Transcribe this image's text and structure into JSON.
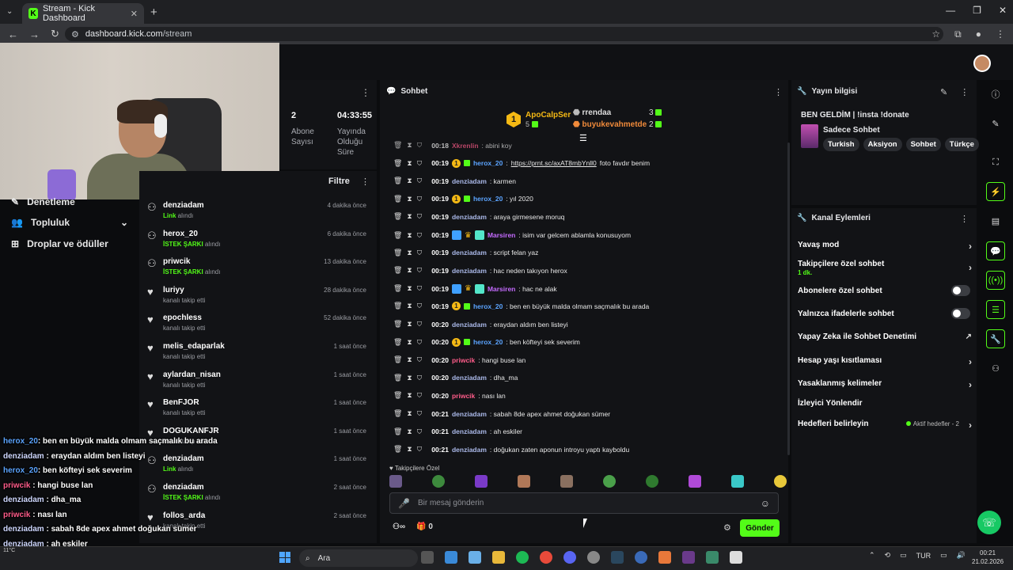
{
  "browser": {
    "tab_title": "Stream - Kick Dashboard",
    "url_host": "dashboard.kick.com",
    "url_path": "/stream"
  },
  "nav": {
    "items": [
      {
        "label": "Denetleme"
      },
      {
        "label": "Topluluk"
      },
      {
        "label": "Droplar ve ödüller"
      }
    ]
  },
  "stats": [
    {
      "value": "2",
      "label": "Abone Sayısı"
    },
    {
      "value": "04:33:55",
      "label": "Yayında Olduğu Süre"
    }
  ],
  "feed": {
    "title": "Filtre",
    "items": [
      {
        "user": "denziadam",
        "highlight": "Link",
        "action": " alındı",
        "time": "4 dakika önce",
        "type": "gift"
      },
      {
        "user": "herox_20",
        "highlight": "İSTEK ŞARKI",
        "action": " alındı",
        "time": "6 dakika önce",
        "type": "gift"
      },
      {
        "user": "priwcik",
        "highlight": "İSTEK ŞARKI",
        "action": " alındı",
        "time": "13 dakika önce",
        "type": "gift"
      },
      {
        "user": "luriyy",
        "highlight": "",
        "action": "kanalı takip etti",
        "time": "28 dakika önce",
        "type": "follow"
      },
      {
        "user": "epochless",
        "highlight": "",
        "action": "kanalı takip etti",
        "time": "52 dakika önce",
        "type": "follow"
      },
      {
        "user": "melis_edaparlak",
        "highlight": "",
        "action": "kanalı takip etti",
        "time": "1 saat önce",
        "type": "follow"
      },
      {
        "user": "aylardan_nisan",
        "highlight": "",
        "action": "kanalı takip etti",
        "time": "1 saat önce",
        "type": "follow"
      },
      {
        "user": "BenFJOR",
        "highlight": "",
        "action": "kanalı takip etti",
        "time": "1 saat önce",
        "type": "follow"
      },
      {
        "user": "DOGUKANFJR",
        "highlight": "",
        "action": "kanalı takip etti",
        "time": "1 saat önce",
        "type": "follow"
      },
      {
        "user": "denziadam",
        "highlight": "Link",
        "action": " alındı",
        "time": "1 saat önce",
        "type": "gift"
      },
      {
        "user": "denziadam",
        "highlight": "İSTEK ŞARKI",
        "action": " alındı",
        "time": "2 saat önce",
        "type": "gift"
      },
      {
        "user": "follos_arda",
        "highlight": "",
        "action": "kanalı takip etti",
        "time": "2 saat önce",
        "type": "follow"
      }
    ]
  },
  "overlay_chat": [
    {
      "user": "herox_20",
      "text": ": ben en büyük malda olmam saçmalık bu arada",
      "color": "n3"
    },
    {
      "user": "denziadam",
      "text": " : eraydan aldım ben listeyi",
      "color": "n1"
    },
    {
      "user": "herox_20",
      "text": ": ben köfteyi sek severim",
      "color": "n3"
    },
    {
      "user": "priwcik",
      "text": " : hangi buse lan",
      "color": "n2"
    },
    {
      "user": "denziadam",
      "text": " : dha_ma",
      "color": "n1"
    },
    {
      "user": "priwcik",
      "text": " : nası lan",
      "color": "n2"
    },
    {
      "user": "denziadam",
      "text": " : sabah 8de apex ahmet doğukan sümer",
      "color": "n1"
    },
    {
      "user": "denziadam",
      "text": " : ah eskiler",
      "color": "n1"
    },
    {
      "user": "iadam",
      "text": " : doğukan zaten aponun introyu yaptı kayboldu",
      "color": "n1"
    }
  ],
  "chat": {
    "title": "Sohbet",
    "top_gifters": [
      {
        "rank": "1",
        "name": "ApoCalpSer",
        "count": "5"
      },
      {
        "name": "rrendaa",
        "count": "3"
      },
      {
        "name": "buyukevahmetde",
        "count": "2"
      }
    ],
    "messages": [
      {
        "ts": "00:18",
        "user": "Xkrenlin",
        "text": ": abini koy",
        "color": "c4",
        "badges": ""
      },
      {
        "ts": "00:19",
        "user": "herox_20",
        "text": " foto favdır benim",
        "link": "https://prnt.sc/axAT8mbYnll0",
        "color": "c2",
        "badges": "coin"
      },
      {
        "ts": "00:19",
        "user": "denziadam",
        "text": ": karmen",
        "color": "c1",
        "badges": ""
      },
      {
        "ts": "00:19",
        "user": "herox_20",
        "text": ": yıl 2020",
        "color": "c2",
        "badges": "coin"
      },
      {
        "ts": "00:19",
        "user": "denziadam",
        "text": ": araya girmesene moruq",
        "color": "c1",
        "badges": ""
      },
      {
        "ts": "00:19",
        "user": "Marsiren",
        "text": ": isim var gelcem ablamla konusuyom",
        "color": "c3",
        "badges": "multi"
      },
      {
        "ts": "00:19",
        "user": "denziadam",
        "text": ": script felan yaz",
        "color": "c1",
        "badges": ""
      },
      {
        "ts": "00:19",
        "user": "denziadam",
        "text": ": hac neden takıyon herox",
        "color": "c1",
        "badges": ""
      },
      {
        "ts": "00:19",
        "user": "Marsiren",
        "text": ": hac ne alak",
        "color": "c3",
        "badges": "multi"
      },
      {
        "ts": "00:19",
        "user": "herox_20",
        "text": ": ben en büyük malda olmam saçmalık bu arada",
        "color": "c2",
        "badges": "coin"
      },
      {
        "ts": "00:20",
        "user": "denziadam",
        "text": ": eraydan aldım ben listeyi",
        "color": "c1",
        "badges": ""
      },
      {
        "ts": "00:20",
        "user": "herox_20",
        "text": ": ben köfteyi sek severim",
        "color": "c2",
        "badges": "coin"
      },
      {
        "ts": "00:20",
        "user": "priwcik",
        "text": ": hangi buse lan",
        "color": "c4",
        "badges": ""
      },
      {
        "ts": "00:20",
        "user": "denziadam",
        "text": ": dha_ma",
        "color": "c1",
        "badges": ""
      },
      {
        "ts": "00:20",
        "user": "priwcik",
        "text": ": nası lan",
        "color": "c4",
        "badges": ""
      },
      {
        "ts": "00:21",
        "user": "denziadam",
        "text": ": sabah 8de apex ahmet doğukan sümer",
        "color": "c1",
        "badges": ""
      },
      {
        "ts": "00:21",
        "user": "denziadam",
        "text": ": ah eskiler",
        "color": "c1",
        "badges": ""
      },
      {
        "ts": "00:21",
        "user": "denziadam",
        "text": ": doğukan zaten aponun introyu yaptı kayboldu",
        "color": "c1",
        "badges": ""
      }
    ],
    "mode_label": "Takipçilere Özel",
    "input_placeholder": "Bir mesaj gönderin",
    "points": "0",
    "send_label": "Gönder"
  },
  "stream_info": {
    "title": "Yayın bilgisi",
    "stream_title": "BEN GELDİM | !insta !donate",
    "category": "Sadece Sohbet",
    "tags": [
      "Turkish",
      "Aksiyon",
      "Sohbet",
      "Türkçe"
    ]
  },
  "channel_actions": {
    "title": "Kanal Eylemleri",
    "items": [
      {
        "label": "Yavaş mod",
        "kind": "chevron"
      },
      {
        "label": "Takipçilere özel sohbet",
        "sub": "1 dk.",
        "kind": "chevron"
      },
      {
        "label": "Abonelere özel sohbet",
        "kind": "toggle"
      },
      {
        "label": "Yalnızca ifadelerle sohbet",
        "kind": "toggle"
      },
      {
        "label": "Yapay Zeka ile Sohbet Denetimi",
        "kind": "external"
      },
      {
        "label": "Hesap yaşı kısıtlaması",
        "kind": "chevron"
      },
      {
        "label": "Yasaklanmış kelimeler",
        "kind": "chevron"
      },
      {
        "label": "İzleyici Yönlendir",
        "kind": "none"
      },
      {
        "label": "Hedefleri belirleyin",
        "kind": "goals",
        "goal_info": "Aktif hedefler - 2"
      }
    ]
  },
  "taskbar": {
    "search_label": "Ara",
    "weather": "11°C",
    "lang": "TUR",
    "time": "00:21",
    "date": "21.02.2026"
  }
}
